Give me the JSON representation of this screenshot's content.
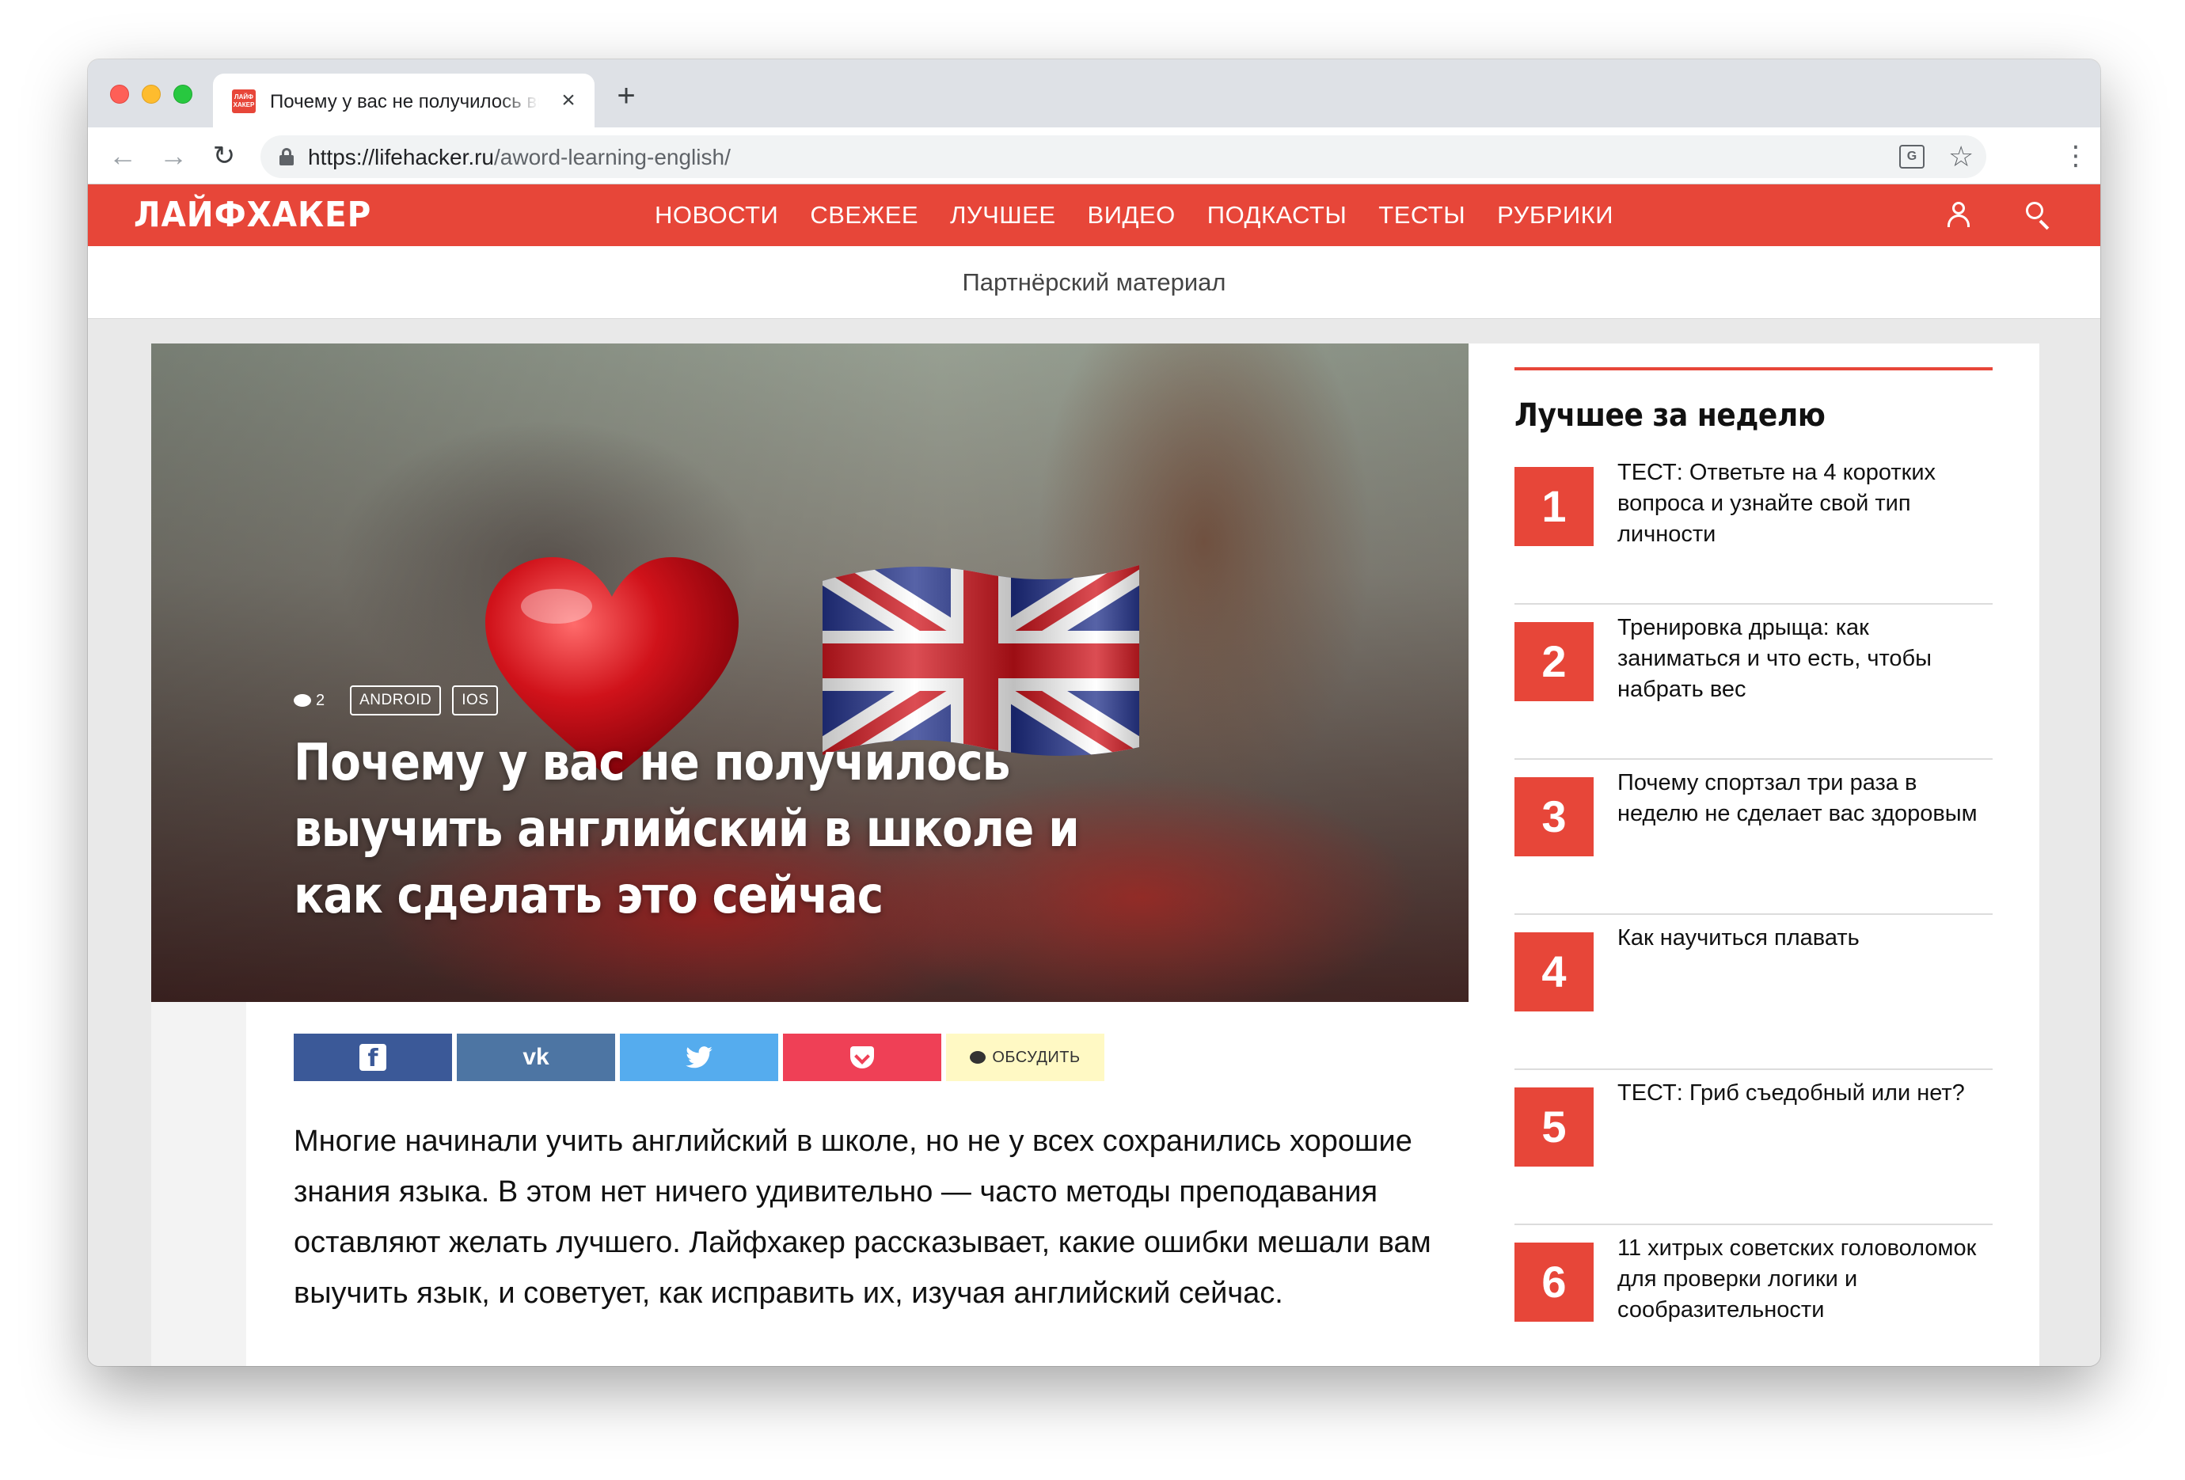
{
  "browser": {
    "tab_title": "Почему у вас не получилось выучить английский в школе и как сделать это сейчас",
    "url_host": "https://lifehacker.ru",
    "url_path": "/aword-learning-english/",
    "favicon_text": "ЛАЙФ ХАКЕР"
  },
  "site": {
    "logo": "ЛАЙФХАКЕР",
    "menu": [
      "НОВОСТИ",
      "СВЕЖЕЕ",
      "ЛУЧШЕЕ",
      "ВИДЕО",
      "ПОДКАСТЫ",
      "ТЕСТЫ",
      "РУБРИКИ"
    ],
    "partner_label": "Партнёрский материал",
    "brand_color": "#e74639"
  },
  "article": {
    "comments_count": "2",
    "tags": [
      "ANDROID",
      "IOS"
    ],
    "title": "Почему у вас не получилось выучить английский в школе и как сделать это сейчас",
    "discuss_label": "ОБСУДИТЬ",
    "lead": "Многие начинали учить английский в школе, но не у всех сохранились хорошие знания языка. В этом нет ничего удивительно — часто методы преподавания оставляют желать лучшего. Лайфхакер рассказывает, какие ошибки мешали вам выучить язык, и советует, как исправить их, изучая английский сейчас."
  },
  "sidebar": {
    "title": "Лучшее за неделю",
    "items": [
      {
        "num": "1",
        "text": "ТЕСТ: Ответьте на 4 коротких вопроса и узнайте свой тип личности"
      },
      {
        "num": "2",
        "text": "Тренировка дрыща: как заниматься и что есть, чтобы набрать вес"
      },
      {
        "num": "3",
        "text": "Почему спортзал три раза в неделю не сделает вас здоровым"
      },
      {
        "num": "4",
        "text": "Как научиться плавать"
      },
      {
        "num": "5",
        "text": "ТЕСТ: Гриб съедобный или нет?"
      },
      {
        "num": "6",
        "text": "11 хитрых советских головоломок для проверки логики и сообразительности"
      }
    ]
  }
}
